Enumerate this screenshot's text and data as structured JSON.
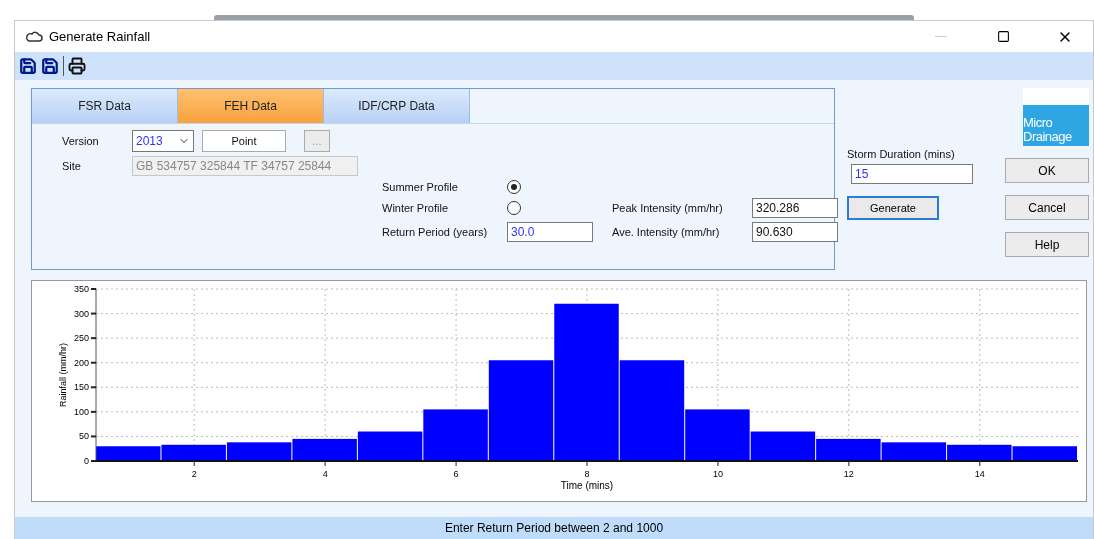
{
  "window": {
    "title": "Generate Rainfall"
  },
  "tabs": [
    {
      "label": "FSR Data",
      "selected": false
    },
    {
      "label": "FEH Data",
      "selected": true
    },
    {
      "label": "IDF/CRP Data",
      "selected": false
    }
  ],
  "version": {
    "label": "Version",
    "value": "2013",
    "point_button": "Point",
    "browse_button": "..."
  },
  "site": {
    "label": "Site",
    "value": "GB 534757 325844 TF 34757 25844",
    "disabled": true
  },
  "profiles": [
    {
      "label": "Summer Profile",
      "selected": true
    },
    {
      "label": "Winter Profile",
      "selected": false
    }
  ],
  "return_period": {
    "label": "Return Period (years)",
    "value": "30.0"
  },
  "peak_intensity": {
    "label": "Peak Intensity (mm/hr)",
    "value": "320.286"
  },
  "ave_intensity": {
    "label": "Ave. Intensity (mm/hr)",
    "value": "90.630"
  },
  "storm_duration": {
    "label": "Storm Duration (mins)",
    "value": "15"
  },
  "generate_button": "Generate",
  "logo": {
    "line_1": "Micro",
    "line_2": "Drainage"
  },
  "buttons": [
    "OK",
    "Cancel",
    "Help"
  ],
  "chart_data": {
    "type": "bar",
    "xlabel": "Time (mins)",
    "ylabel": "Rainfall (mm/hr)",
    "x": [
      1,
      2,
      3,
      4,
      5,
      6,
      7,
      8,
      9,
      10,
      11,
      12,
      13,
      14,
      15
    ],
    "grid": true,
    "series": [
      {
        "color": "#0000ff",
        "values": [
          30,
          33,
          38,
          45,
          60,
          105,
          205,
          320,
          205,
          105,
          60,
          45,
          38,
          33,
          30
        ]
      }
    ],
    "xlim": [
      0.5,
      15.5
    ],
    "ylim": [
      0,
      350
    ],
    "xticks": [
      2,
      4,
      6,
      8,
      10,
      12,
      14
    ],
    "yticks": [
      0,
      50,
      100,
      150,
      200,
      250,
      300,
      350
    ]
  },
  "status_bar": "Enter Return Period between 2 and 1000"
}
